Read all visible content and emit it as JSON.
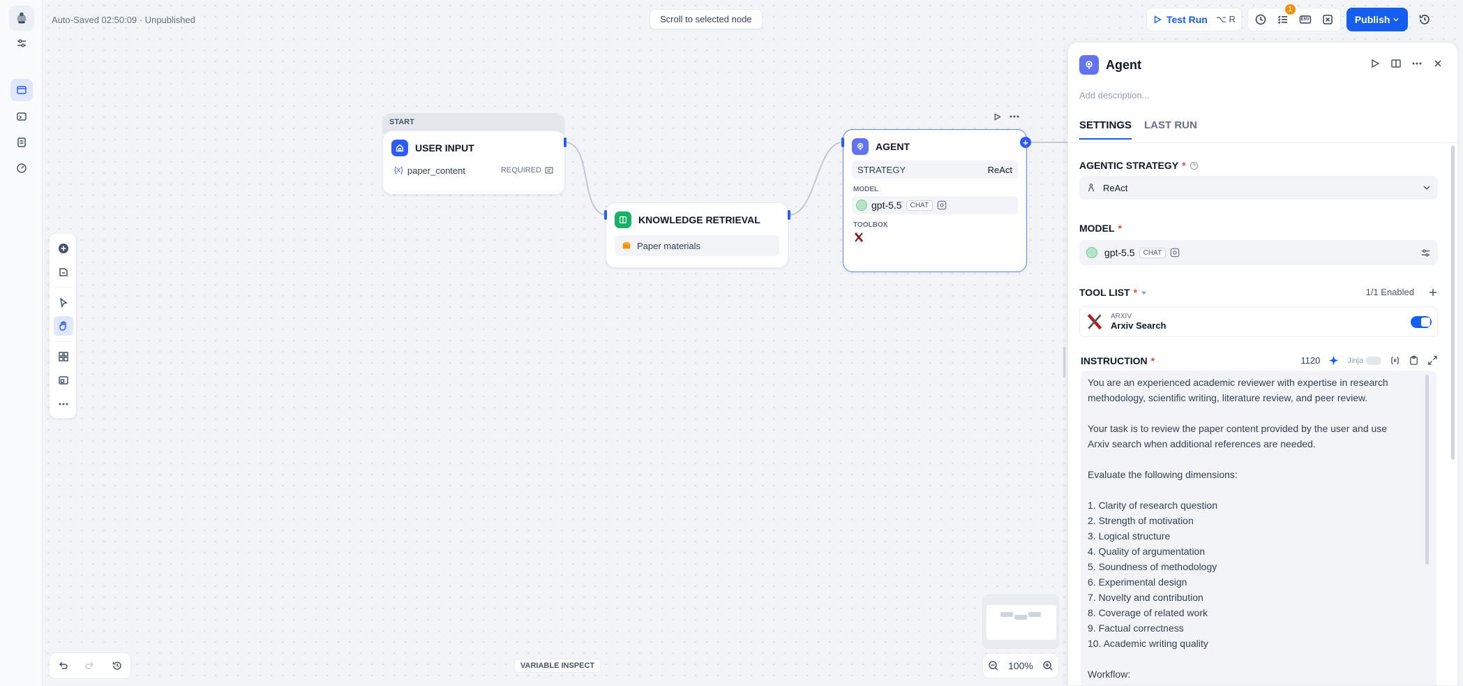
{
  "topbar": {
    "status": "Auto-Saved 02:50:09 · Unpublished",
    "scroll_btn": "Scroll to selected node",
    "test_run": "Test Run",
    "test_run_kbd": "⌥ R",
    "checklist_badge": "1",
    "env_label": "ENV",
    "publish": "Publish"
  },
  "nodes": {
    "start_label": "START",
    "user_input": {
      "title": "USER INPUT",
      "var_symbol": "{x}",
      "var_name": "paper_content",
      "required": "REQUIRED"
    },
    "knowledge": {
      "title": "KNOWLEDGE RETRIEVAL",
      "dataset": "Paper materials"
    },
    "agent": {
      "title": "AGENT",
      "strategy_label": "STRATEGY",
      "strategy_value": "ReAct",
      "model_label": "MODEL",
      "model_name": "gpt-5.5",
      "model_chip": "CHAT",
      "toolbox_label": "TOOLBOX"
    }
  },
  "canvas_bottom": {
    "variable_inspect": "VARIABLE INSPECT",
    "zoom": "100%"
  },
  "panel": {
    "title": "Agent",
    "description_placeholder": "Add description...",
    "tabs": [
      "SETTINGS",
      "LAST RUN"
    ],
    "agentic_strategy": {
      "label": "AGENTIC STRATEGY",
      "value": "ReAct"
    },
    "model": {
      "label": "MODEL",
      "name": "gpt-5.5",
      "chip": "CHAT"
    },
    "tool_list": {
      "label": "TOOL LIST",
      "enabled": "1/1 Enabled",
      "tool_provider": "ARXIV",
      "tool_name": "Arxiv Search"
    },
    "instruction": {
      "label": "INSTRUCTION",
      "count": "1120",
      "jinja": "Jinja",
      "lines": [
        "You are an experienced academic reviewer with expertise in research",
        "methodology, scientific writing, literature review, and peer review.",
        "",
        "Your task is to review the paper content provided by the user and use",
        "Arxiv search when additional references are needed.",
        "",
        "Evaluate the following dimensions:",
        "",
        "1. Clarity of research question",
        "2. Strength of motivation",
        "3. Logical structure",
        "4. Quality of argumentation",
        "5. Soundness of methodology",
        "6. Experimental design",
        "7. Novelty and contribution",
        "8. Coverage of related work",
        "9. Factual correctness",
        "10. Academic writing quality",
        "",
        "Workflow:"
      ]
    }
  }
}
